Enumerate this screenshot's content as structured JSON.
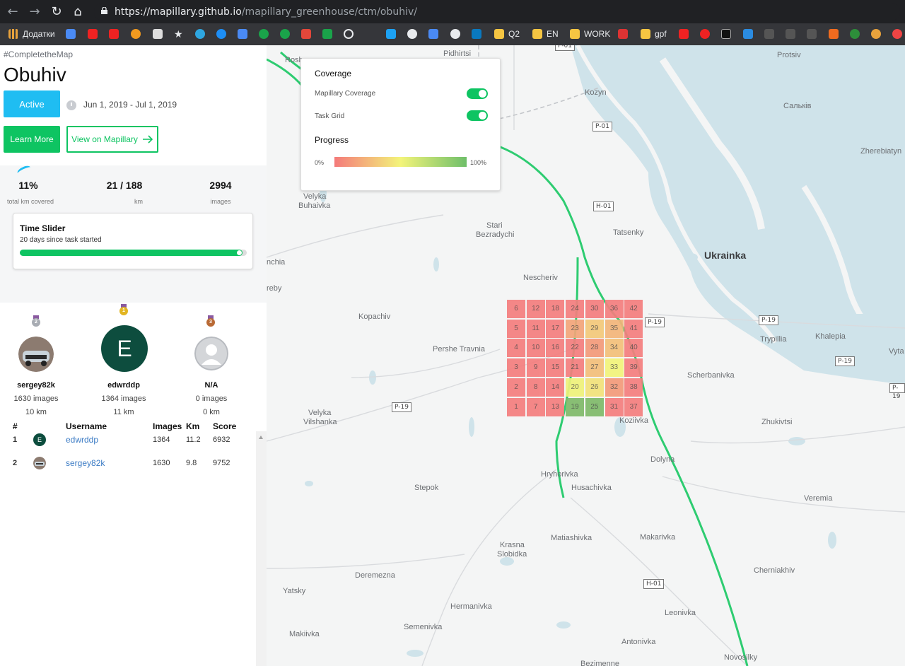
{
  "browser": {
    "url_host": "https://mapillary.github.io",
    "url_path": "/mapillary_greenhouse/ctm/obuhiv/",
    "bookmarks": [
      {
        "label": "Додатки",
        "color": "#e8a23c"
      },
      {
        "label": "Q2",
        "color": "#f5c542"
      },
      {
        "label": "EN",
        "color": "#f5c542"
      },
      {
        "label": "WORK",
        "color": "#f5c542"
      },
      {
        "label": "gpf",
        "color": "#f5c542"
      }
    ]
  },
  "task": {
    "hashtag": "#CompletetheMap",
    "title": "Obuhiv",
    "status": "Active",
    "dates": "Jun 1, 2019 - Jul 1, 2019",
    "learn_more": "Learn More",
    "view_on": "View on Mapillary"
  },
  "stats": {
    "percent": "11%",
    "percent_label": "total km covered",
    "km": "21 / 188",
    "km_label": "km",
    "images": "2994",
    "images_label": "images"
  },
  "time_slider": {
    "title": "Time Slider",
    "subtitle": "20 days since task started",
    "progress": 0.98
  },
  "podium": [
    {
      "rank": "2",
      "name": "sergey82k",
      "images": "1630 images",
      "km": "10 km",
      "medal": "#a8acb3"
    },
    {
      "rank": "1",
      "name": "edwrddp",
      "images": "1364 images",
      "km": "11 km",
      "initial": "E",
      "medal": "#e2b522"
    },
    {
      "rank": "3",
      "name": "N/A",
      "images": "0 images",
      "km": "0 km",
      "medal": "#b96a35"
    }
  ],
  "leaderboard": {
    "headers": {
      "rank": "#",
      "username": "Username",
      "images": "Images",
      "km": "Km",
      "score": "Score"
    },
    "rows": [
      {
        "rank": "1",
        "username": "edwrddp",
        "images": "1364",
        "km": "11.2",
        "score": "6932",
        "initial": "E"
      },
      {
        "rank": "2",
        "username": "sergey82k",
        "images": "1630",
        "km": "9.8",
        "score": "9752"
      }
    ]
  },
  "legend": {
    "title": "Coverage",
    "mapillary_coverage": "Mapillary Coverage",
    "task_grid": "Task Grid",
    "progress_title": "Progress",
    "min": "0%",
    "max": "100%",
    "coverage_on": true,
    "grid_on": true
  },
  "map": {
    "places": [
      {
        "name": "Pidhirtsi"
      },
      {
        "name": "Kozyn"
      },
      {
        "name": "Protsiv"
      },
      {
        "name": "Сальків"
      },
      {
        "name": "Zherebiatyn"
      },
      {
        "name": "Velyka"
      },
      {
        "name": "Buhaivka"
      },
      {
        "name": "Stari"
      },
      {
        "name": "Bezradychi"
      },
      {
        "name": "Tatsenky"
      },
      {
        "name": "Ukrainka"
      },
      {
        "name": "Nescheriv"
      },
      {
        "name": "Kopachiv"
      },
      {
        "name": "Pershe Travnia"
      },
      {
        "name": "Trypillia"
      },
      {
        "name": "Khalepia"
      },
      {
        "name": "Scherbanivka"
      },
      {
        "name": "Koziivka"
      },
      {
        "name": "Zhukivtsi"
      },
      {
        "name": "Dolyna"
      },
      {
        "name": "Vilshanka"
      },
      {
        "name": "Hryhorivka"
      },
      {
        "name": "Husachivka"
      },
      {
        "name": "Stepok"
      },
      {
        "name": "Veremia"
      },
      {
        "name": "Matiashivka"
      },
      {
        "name": "Makarivka"
      },
      {
        "name": "Krasna"
      },
      {
        "name": "Slobidka"
      },
      {
        "name": "Deremezna"
      },
      {
        "name": "Cherniakhiv"
      },
      {
        "name": "Yatsky"
      },
      {
        "name": "Hermanivka"
      },
      {
        "name": "Leonivka"
      },
      {
        "name": "Semenivka"
      },
      {
        "name": "Makiivka"
      },
      {
        "name": "Antonivka"
      },
      {
        "name": "Novosilky"
      },
      {
        "name": "Bezimenne"
      },
      {
        "name": "Rosh"
      },
      {
        "name": "nchia"
      },
      {
        "name": "reby"
      },
      {
        "name": "Vytа"
      }
    ],
    "shields": [
      "P-01",
      "P-01",
      "H-01",
      "P-19",
      "P-19",
      "P-19",
      "P-19",
      "P-19",
      "H-01"
    ],
    "grid_cells": [
      {
        "n": 1,
        "c": "#f47e7e"
      },
      {
        "n": 2,
        "c": "#f47e7e"
      },
      {
        "n": 3,
        "c": "#f47e7e"
      },
      {
        "n": 4,
        "c": "#f47e7e"
      },
      {
        "n": 5,
        "c": "#f47e7e"
      },
      {
        "n": 6,
        "c": "#f47e7e"
      },
      {
        "n": 7,
        "c": "#f47e7e"
      },
      {
        "n": 8,
        "c": "#f47e7e"
      },
      {
        "n": 9,
        "c": "#f47e7e"
      },
      {
        "n": 10,
        "c": "#f47e7e"
      },
      {
        "n": 11,
        "c": "#f47e7e"
      },
      {
        "n": 12,
        "c": "#f47e7e"
      },
      {
        "n": 13,
        "c": "#f47e7e"
      },
      {
        "n": 14,
        "c": "#f47e7e"
      },
      {
        "n": 15,
        "c": "#f47e7e"
      },
      {
        "n": 16,
        "c": "#f47e7e"
      },
      {
        "n": 17,
        "c": "#f47e7e"
      },
      {
        "n": 18,
        "c": "#f47e7e"
      },
      {
        "n": 19,
        "c": "#7fba6a"
      },
      {
        "n": 20,
        "c": "#eff27a"
      },
      {
        "n": 21,
        "c": "#f47e7e"
      },
      {
        "n": 22,
        "c": "#f47e7e"
      },
      {
        "n": 23,
        "c": "#f3a57a"
      },
      {
        "n": 24,
        "c": "#f47e7e"
      },
      {
        "n": 25,
        "c": "#7fba6a"
      },
      {
        "n": 26,
        "c": "#f2e27a"
      },
      {
        "n": 27,
        "c": "#f3bf7a"
      },
      {
        "n": 28,
        "c": "#f39a7a"
      },
      {
        "n": 29,
        "c": "#f3c97a"
      },
      {
        "n": 30,
        "c": "#f47e7e"
      },
      {
        "n": 31,
        "c": "#f47e7e"
      },
      {
        "n": 32,
        "c": "#f39a7a"
      },
      {
        "n": 33,
        "c": "#f2f47a"
      },
      {
        "n": 34,
        "c": "#f3c07a"
      },
      {
        "n": 35,
        "c": "#f3b57a"
      },
      {
        "n": 36,
        "c": "#f47e7e"
      },
      {
        "n": 37,
        "c": "#f47e7e"
      },
      {
        "n": 38,
        "c": "#f47e7e"
      },
      {
        "n": 39,
        "c": "#f47e7e"
      },
      {
        "n": 40,
        "c": "#f47e7e"
      },
      {
        "n": 41,
        "c": "#f47e7e"
      },
      {
        "n": 42,
        "c": "#f47e7e"
      }
    ]
  }
}
